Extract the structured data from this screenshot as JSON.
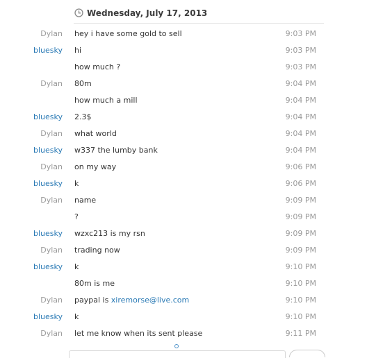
{
  "date_header": {
    "icon": "clock-icon",
    "label": "Wednesday, July 17, 2013"
  },
  "messages": [
    {
      "sender": "Dylan",
      "text": "hey i have some gold to sell",
      "time": "9:03 PM"
    },
    {
      "sender": "bluesky",
      "text": "hi",
      "time": "9:03 PM"
    },
    {
      "sender": "",
      "text": "how much ?",
      "time": "9:03 PM"
    },
    {
      "sender": "Dylan",
      "text": "80m",
      "time": "9:04 PM"
    },
    {
      "sender": "",
      "text": "how much a mill",
      "time": "9:04 PM"
    },
    {
      "sender": "bluesky",
      "text": "2.3$",
      "time": "9:04 PM"
    },
    {
      "sender": "Dylan",
      "text": "what world",
      "time": "9:04 PM"
    },
    {
      "sender": "bluesky",
      "text": "w337 the lumby bank",
      "time": "9:04 PM"
    },
    {
      "sender": "Dylan",
      "text": "on my way",
      "time": "9:06 PM"
    },
    {
      "sender": "bluesky",
      "text": "k",
      "time": "9:06 PM"
    },
    {
      "sender": "Dylan",
      "text": "name",
      "time": "9:09 PM"
    },
    {
      "sender": "",
      "text": "?",
      "time": "9:09 PM"
    },
    {
      "sender": "bluesky",
      "text": "wzxc213  is my rsn",
      "time": "9:09 PM"
    },
    {
      "sender": "Dylan",
      "text": "trading now",
      "time": "9:09 PM"
    },
    {
      "sender": "bluesky",
      "text": "k",
      "time": "9:10 PM"
    },
    {
      "sender": "",
      "text": "80m is me",
      "time": "9:10 PM"
    },
    {
      "sender": "Dylan",
      "text": "paypal is ",
      "link": "xiremorse@live.com",
      "time": "9:10 PM"
    },
    {
      "sender": "bluesky",
      "text": "k",
      "time": "9:10 PM"
    },
    {
      "sender": "Dylan",
      "text": "let me know when its sent please",
      "time": "9:11 PM"
    }
  ],
  "colors": {
    "dylan": "#9a9a9a",
    "bluesky": "#2a7ab5",
    "link": "#2a7ab5"
  }
}
